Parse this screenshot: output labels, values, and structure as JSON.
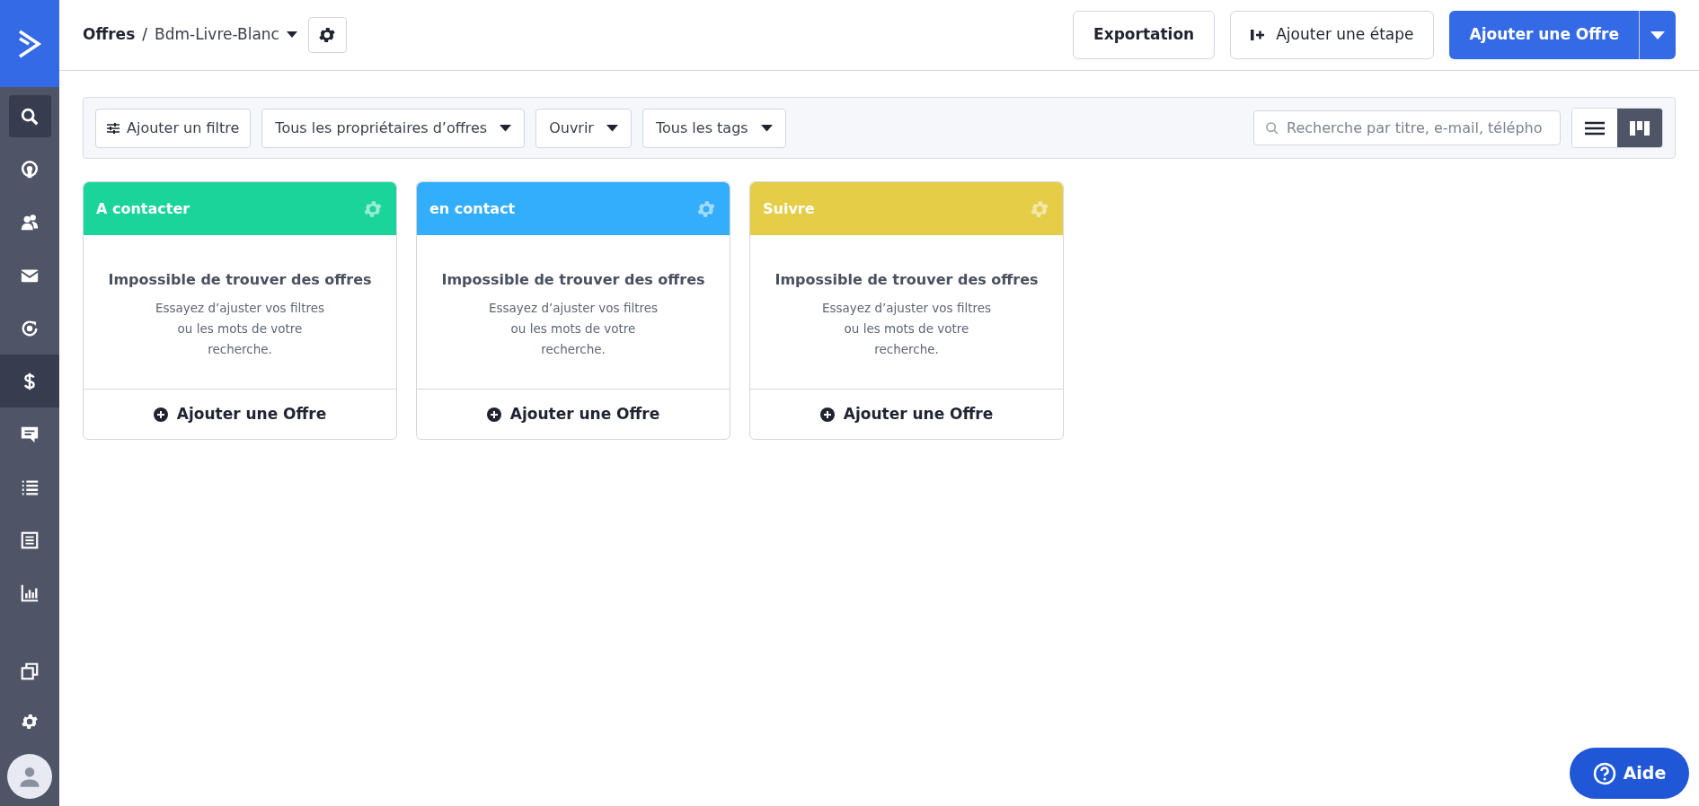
{
  "sidebar": {
    "items": [
      {
        "selected": false
      },
      {
        "selected": false
      },
      {
        "selected": false
      },
      {
        "selected": false
      },
      {
        "selected": false
      },
      {
        "selected": true
      },
      {
        "selected": false
      },
      {
        "selected": false
      },
      {
        "selected": false
      },
      {
        "selected": false
      }
    ]
  },
  "header": {
    "breadcrumb": "Offres",
    "separator": "/",
    "pipeline": "Bdm-Livre-Blanc",
    "buttons": [
      {
        "label": "Exportation",
        "kind": "plain"
      },
      {
        "label": "Ajouter une étape",
        "kind": "stage"
      },
      {
        "label": "Ajouter une Offre",
        "kind": "primary"
      }
    ]
  },
  "filters": {
    "add_filter": "Ajouter un filtre",
    "dropdowns": [
      "Tous les propriétaires d’offres",
      "Ouvrir",
      "Tous les tags"
    ],
    "search": {
      "placeholder": "Recherche par titre, e-mail, télépho"
    },
    "views": [
      {
        "selected": false
      },
      {
        "selected": true
      }
    ]
  },
  "stages": [
    {
      "title": "A contacter",
      "color": "#1bd49a",
      "empty_title": "Impossible de trouver des offres",
      "empty_text": [
        "Essayez d’ajuster vos filtres",
        "ou les mots de votre",
        "recherche."
      ],
      "add": "Ajouter une Offre"
    },
    {
      "title": "en contact",
      "color": "#33aefc",
      "empty_title": "Impossible de trouver des offres",
      "empty_text": [
        "Essayez d’ajuster vos filtres",
        "ou les mots de votre",
        "recherche."
      ],
      "add": "Ajouter une Offre"
    },
    {
      "title": "Suivre",
      "color": "#e5cd47",
      "empty_title": "Impossible de trouver des offres",
      "empty_text": [
        "Essayez d’ajuster vos filtres",
        "ou les mots de votre",
        "recherche."
      ],
      "add": "Ajouter une Offre"
    }
  ],
  "help": {
    "label": "Aide"
  }
}
